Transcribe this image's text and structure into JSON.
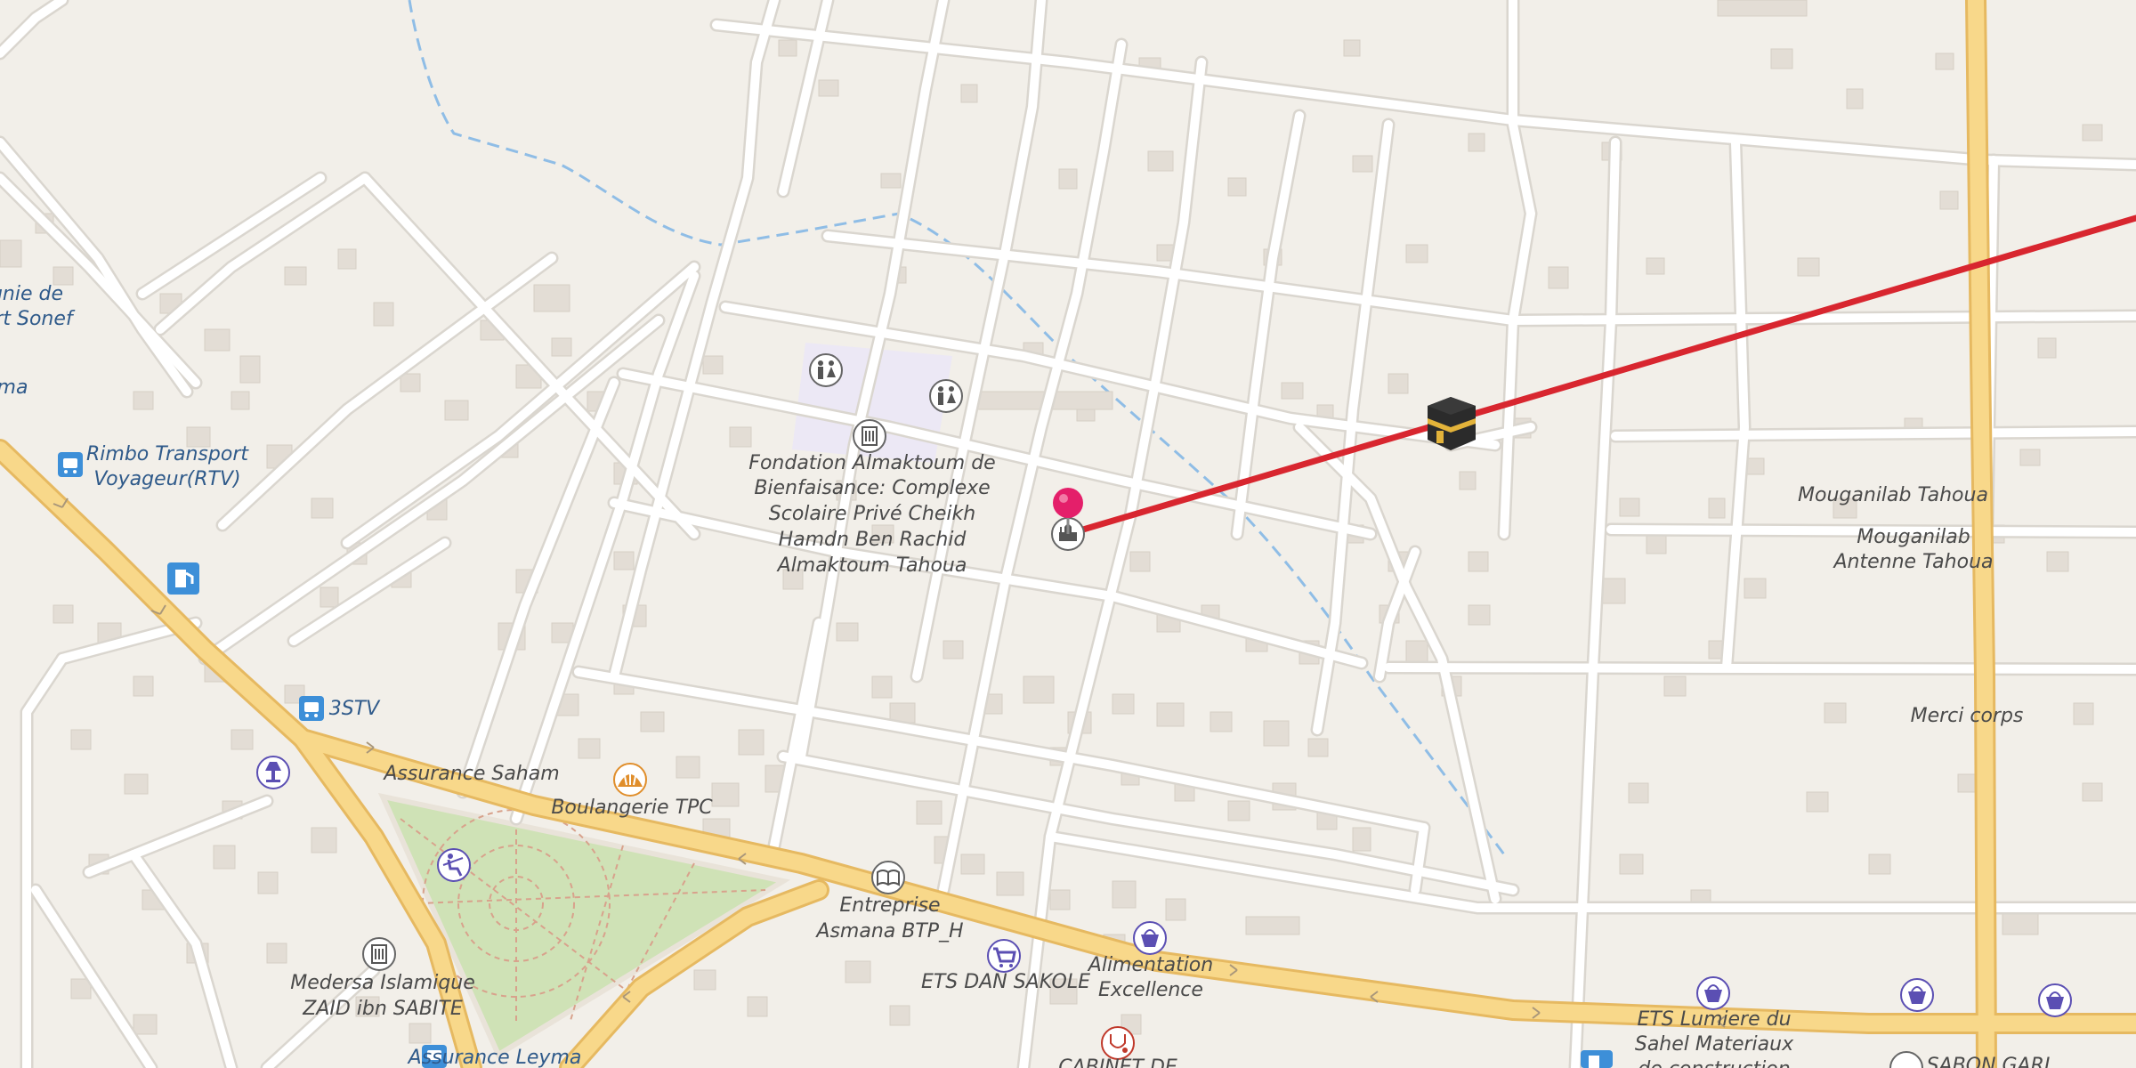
{
  "map": {
    "colors": {
      "land": "#f2efe9",
      "minor_road": "#ffffff",
      "road_casing": "#dad6cf",
      "primary_road": "#f8d88a",
      "primary_casing": "#e6b961",
      "building": "#e3ddd5",
      "park": "#cfe2b6",
      "school_area": "#ece8f5",
      "stream": "#8fbde6",
      "route_line": "#d8262f",
      "pin": "#e41f6a",
      "poi_dark": "#555555",
      "poi_shop": "#5b4fb3",
      "poi_transport": "#3d8fd8",
      "poi_bakery": "#e08e2b"
    },
    "labels": {
      "compagnie_line1": "gnie de",
      "compagnie_line2": "rt Sonef",
      "left_edge": "ma",
      "rimbo_line1": "Rimbo Transport",
      "rimbo_line2": "Voyageur(RTV)",
      "fondation_line1": "Fondation Almaktoum de",
      "fondation_line2": "Bienfaisance: Complexe",
      "fondation_line3": "Scolaire Privé Cheikh",
      "fondation_line4": "Hamdn Ben Rachid",
      "fondation_line5": "Almaktoum Tahoua",
      "mouganilab_tahoua": "Mouganilab Tahoua",
      "mouganilab_antenne_line1": "Mouganilab",
      "mouganilab_antenne_line2": "Antenne Tahoua",
      "stv": "3STV",
      "merci_corps": "Merci corps",
      "assurance_saham": "Assurance Saham",
      "boulangerie": "Boulangerie TPC",
      "entreprise_line1": "Entreprise",
      "entreprise_line2": "Asmana BTP_H",
      "ets_dan_sakole": "ETS DAN SAKOLE",
      "alimentation_line1": "Alimentation",
      "alimentation_line2": "Excellence",
      "medersa_line1": "Medersa Islamique",
      "medersa_line2": "ZAID ibn SABITE",
      "assurance_leyma": "Assurance Leyma",
      "cabinet": "CABINET DE",
      "ets_lumiere_line1": "ETS Lumiere du",
      "ets_lumiere_line2": "Sahel Materiaux",
      "ets_lumiere_line3": "de construction",
      "sabon_gari": "SABON GARI"
    },
    "icons": [
      "bus-station-icon",
      "fuel-station-icon",
      "toilets-icon",
      "school-icon",
      "mosque-icon",
      "kaaba-icon",
      "bakery-icon",
      "playground-icon",
      "lamp-shop-icon",
      "bookshop-icon",
      "supermarket-icon",
      "shopping-basket-icon",
      "doctor-icon",
      "location-pin-icon"
    ]
  }
}
